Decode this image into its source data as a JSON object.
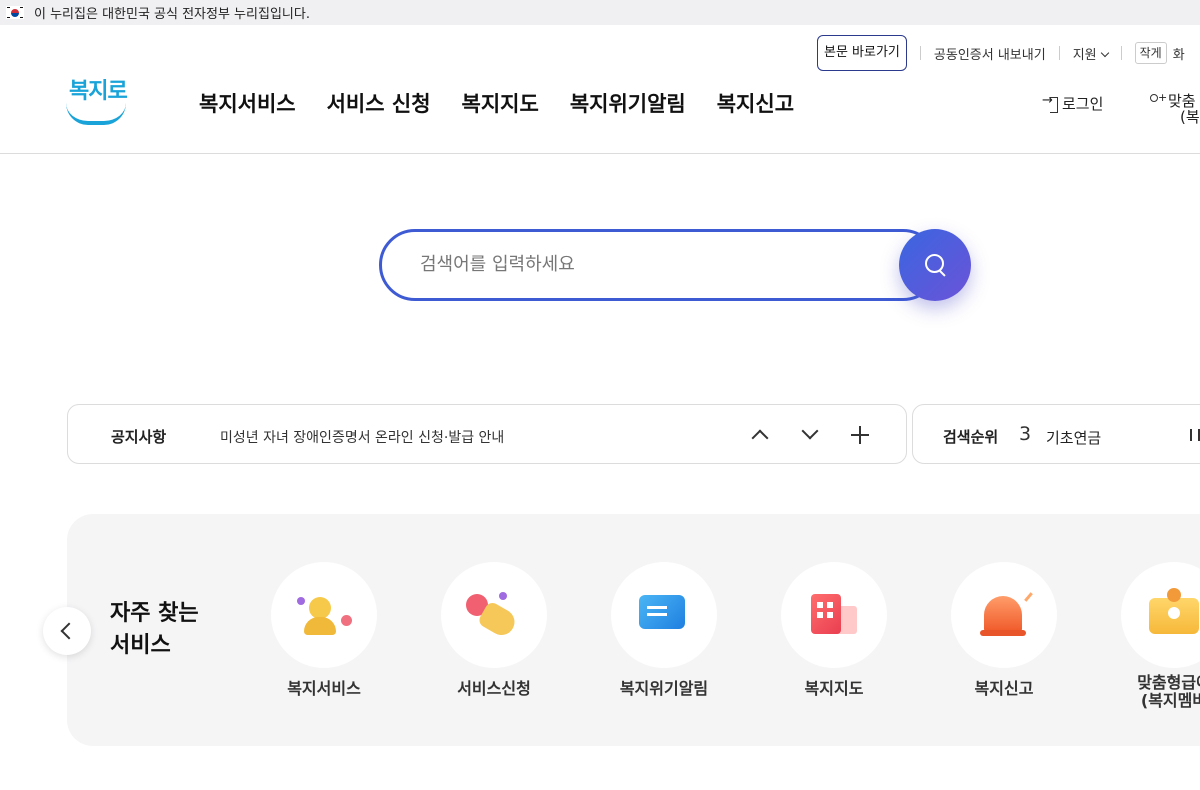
{
  "gov_bar": {
    "text": "이 누리집은 대한민국 공식 전자정부 누리집입니다."
  },
  "utility": {
    "skip": "본문 바로가기",
    "cert": "공동인증서 내보내기",
    "support": "지원",
    "font_size": "작게",
    "extra": "화"
  },
  "logo": {
    "text": "복지로"
  },
  "nav": [
    "복지서비스",
    "서비스 신청",
    "복지지도",
    "복지위기알림",
    "복지신고"
  ],
  "account": {
    "login": "로그인",
    "signup_line1": "맞춤",
    "signup_line2": "(복"
  },
  "search": {
    "placeholder": "검색어를 입력하세요"
  },
  "notice": {
    "label": "공지사항",
    "text": "미성년 자녀 장애인증명서 온라인 신청·발급 안내"
  },
  "ranking": {
    "label": "검색순위",
    "number": "3",
    "term": "기초연금"
  },
  "favorites": {
    "title_line1": "자주 찾는",
    "title_line2": "서비스",
    "items": [
      {
        "label": "복지서비스",
        "icon": "people-icon"
      },
      {
        "label": "서비스신청",
        "icon": "hand-tap-icon"
      },
      {
        "label": "복지위기알림",
        "icon": "message-icon"
      },
      {
        "label": "복지지도",
        "icon": "building-icon"
      },
      {
        "label": "복지신고",
        "icon": "siren-icon"
      },
      {
        "label_line1": "맞춤형급여",
        "label_line2": "(복지멤버",
        "icon": "id-card-icon"
      }
    ]
  }
}
